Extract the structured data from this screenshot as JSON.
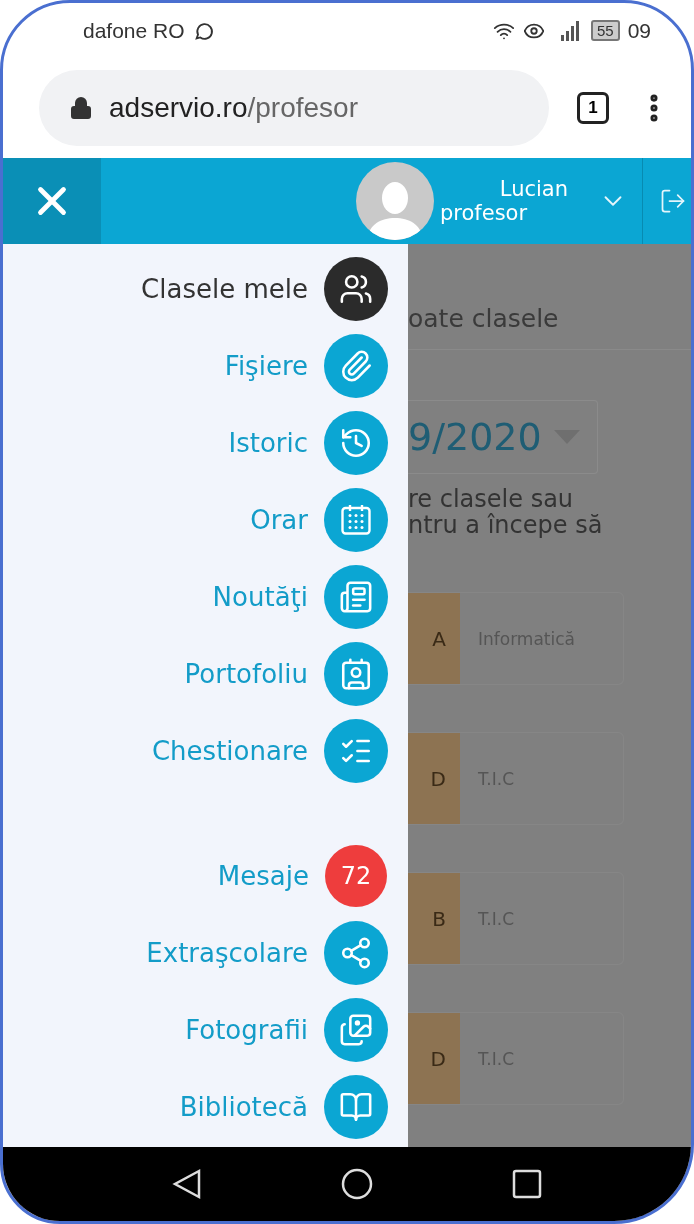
{
  "status_bar": {
    "carrier": "dafone RO",
    "battery": "55",
    "time": "09"
  },
  "browser": {
    "url_host": "adservio.ro",
    "url_path": "/profesor",
    "tab_count": "1"
  },
  "header": {
    "user_name": "Lucian",
    "user_role": "profesor"
  },
  "menu": {
    "sections": [
      {
        "items": [
          {
            "kind": "icon",
            "label": "Clasele mele",
            "selected": true
          },
          {
            "kind": "icon",
            "label": "Fişiere",
            "selected": false
          },
          {
            "kind": "icon",
            "label": "Istoric",
            "selected": false
          },
          {
            "kind": "icon",
            "label": "Orar",
            "selected": false
          },
          {
            "kind": "icon",
            "label": "Noutăţi",
            "selected": false
          },
          {
            "kind": "icon",
            "label": "Portofoliu",
            "selected": false
          },
          {
            "kind": "icon",
            "label": "Chestionare",
            "selected": false
          }
        ]
      },
      {
        "items": [
          {
            "kind": "badge",
            "label": "Mesaje",
            "badge": "72",
            "selected": false
          },
          {
            "kind": "icon",
            "label": "Extraşcolare",
            "selected": false
          },
          {
            "kind": "icon",
            "label": "Fotografii",
            "selected": false
          },
          {
            "kind": "icon",
            "label": "Bibliotecă",
            "selected": false
          }
        ]
      }
    ]
  },
  "background": {
    "tab": "oate clasele",
    "year": "9/2020",
    "hint_lines": [
      "re clasele sau",
      "ntru a începe să"
    ],
    "cards": [
      {
        "code": "A",
        "subject": "Informatică"
      },
      {
        "code": "D",
        "subject": "T.I.C"
      },
      {
        "code": "B",
        "subject": "T.I.C"
      },
      {
        "code": "D",
        "subject": "T.I.C"
      }
    ]
  }
}
